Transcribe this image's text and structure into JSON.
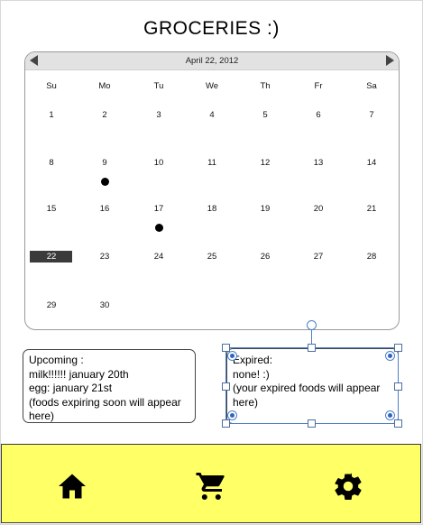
{
  "page": {
    "title": "GROCERIES :)"
  },
  "calendar": {
    "month_label": "April 22, 2012",
    "weekdays": [
      "Su",
      "Mo",
      "Tu",
      "We",
      "Th",
      "Fr",
      "Sa"
    ],
    "selected_day": "22",
    "marked_days": [
      "9",
      "17"
    ],
    "weeks": [
      [
        "1",
        "2",
        "3",
        "4",
        "5",
        "6",
        "7"
      ],
      [
        "8",
        "9",
        "10",
        "11",
        "12",
        "13",
        "14"
      ],
      [
        "15",
        "16",
        "17",
        "18",
        "19",
        "20",
        "21"
      ],
      [
        "22",
        "23",
        "24",
        "25",
        "26",
        "27",
        "28"
      ],
      [
        "29",
        "30",
        "",
        "",
        "",
        "",
        ""
      ]
    ]
  },
  "upcoming": {
    "heading": "Upcoming :",
    "lines": [
      "milk!!!!!! january 20th",
      "egg: january 21st",
      "(foods expiring soon will appear",
      "here)"
    ]
  },
  "expired": {
    "heading": "Expired:",
    "lines": [
      "none! :)",
      "(your expired foods will appear",
      "here)"
    ]
  },
  "nav": {
    "items": [
      {
        "name": "home",
        "icon": "home-icon"
      },
      {
        "name": "cart",
        "icon": "cart-icon"
      },
      {
        "name": "settings",
        "icon": "gear-icon"
      }
    ]
  },
  "colors": {
    "navbar_bg": "#ffff66",
    "selection": "#4d7fc7",
    "today_bg": "#3b3b3b"
  }
}
